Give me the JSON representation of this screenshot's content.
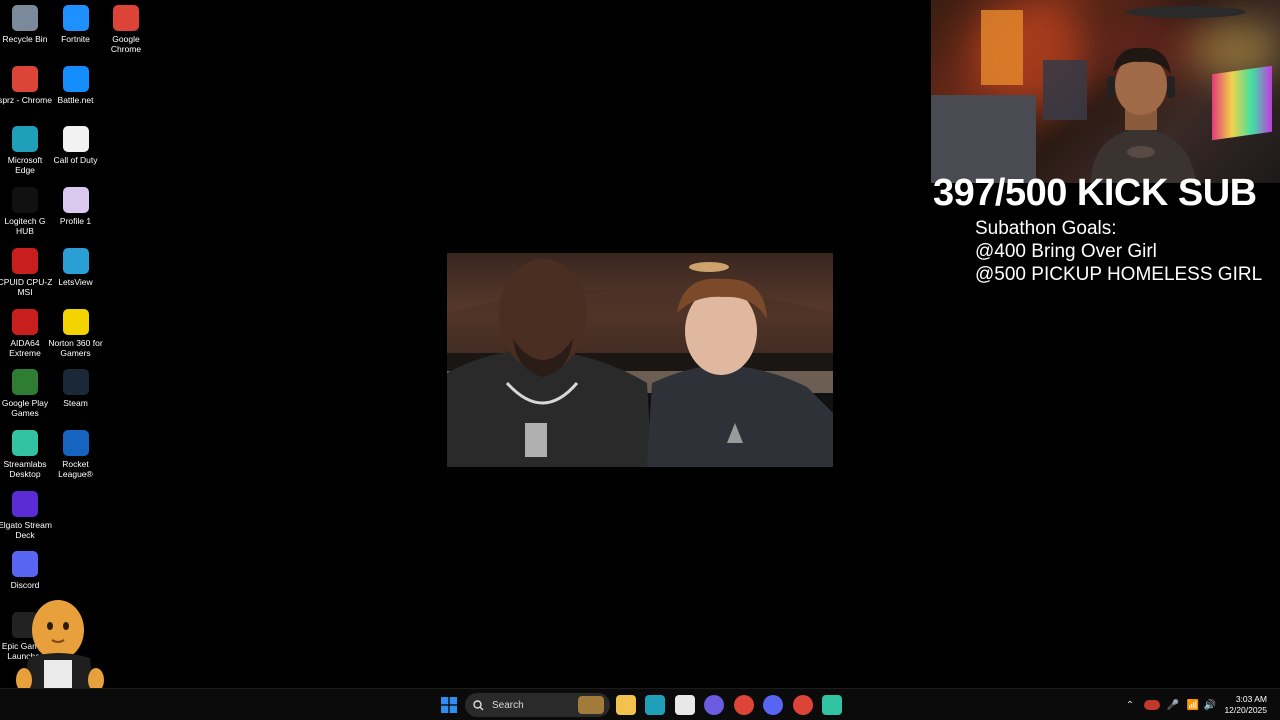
{
  "desktop": {
    "icons": [
      {
        "label": "Recycle Bin",
        "icon": "recycle-bin-icon",
        "color": "#7a8a9a"
      },
      {
        "label": "Fortnite",
        "icon": "fortnite-icon",
        "color": "#1e90ff"
      },
      {
        "label": "Google Chrome",
        "icon": "chrome-icon",
        "color": "#db4437"
      },
      {
        "label": "sprz - Chrome",
        "icon": "chrome-profile-icon",
        "color": "#db4437"
      },
      {
        "label": "Battle.net",
        "icon": "battlenet-icon",
        "color": "#148eff"
      },
      {
        "label": "Microsoft Edge",
        "icon": "edge-icon",
        "color": "#1fa0b8"
      },
      {
        "label": "Call of Duty",
        "icon": "file-icon",
        "color": "#f2f2f2"
      },
      {
        "label": "Logitech G HUB",
        "icon": "logitech-icon",
        "color": "#111111"
      },
      {
        "label": "Profile 1",
        "icon": "profile-file-icon",
        "color": "#d9c8f0"
      },
      {
        "label": "CPUID CPU-Z MSI",
        "icon": "cpuz-icon",
        "color": "#c81e1e"
      },
      {
        "label": "LetsView",
        "icon": "letsview-icon",
        "color": "#2a9fd6"
      },
      {
        "label": "AIDA64 Extreme",
        "icon": "aida64-icon",
        "color": "#c81e1e"
      },
      {
        "label": "Norton 360 for Gamers",
        "icon": "norton-icon",
        "color": "#f3d400"
      },
      {
        "label": "Google Play Games",
        "icon": "play-games-icon",
        "color": "#2e7d32"
      },
      {
        "label": "Steam",
        "icon": "steam-icon",
        "color": "#1b2838"
      },
      {
        "label": "Streamlabs Desktop",
        "icon": "streamlabs-icon",
        "color": "#31c3a2"
      },
      {
        "label": "Rocket League®",
        "icon": "rocket-league-icon",
        "color": "#1565c0"
      },
      {
        "label": "Elgato Stream Deck",
        "icon": "stream-deck-icon",
        "color": "#5b2bd6"
      },
      {
        "label": "Discord",
        "icon": "discord-icon",
        "color": "#5865f2"
      },
      {
        "label": "Epic Games Launcher",
        "icon": "epic-games-icon",
        "color": "#222222"
      }
    ]
  },
  "overlay": {
    "sub_counter": "397/500 KICK SUB",
    "goals_title": "Subathon Goals:",
    "goal_1": "@400 Bring Over Girl",
    "goal_2": "@500 PICKUP HOMELESS GIRL"
  },
  "taskbar": {
    "search_label": "Search",
    "time": "3:03 AM",
    "date": "12/20/2025"
  }
}
